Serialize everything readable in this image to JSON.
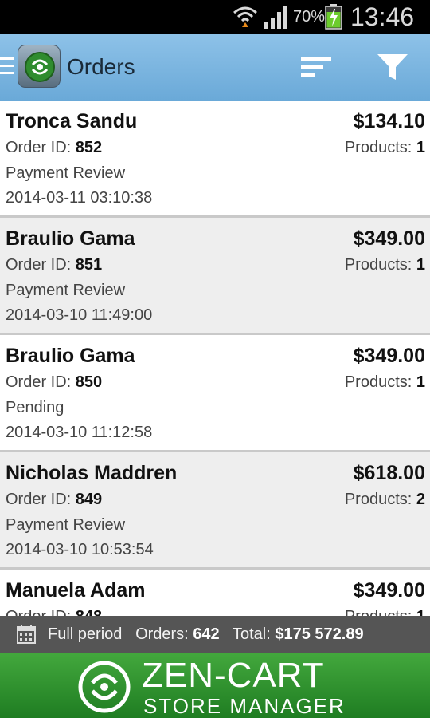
{
  "status_bar": {
    "battery_percent": "70%",
    "time": "13:46"
  },
  "action_bar": {
    "title": "Orders"
  },
  "order_id_label": "Order ID: ",
  "products_label": "Products: ",
  "orders": [
    {
      "customer": "Tronca Sandu",
      "total": "$134.10",
      "order_id": "852",
      "products": "1",
      "status": "Payment Review",
      "date": "2014-03-11 03:10:38"
    },
    {
      "customer": "Braulio Gama",
      "total": "$349.00",
      "order_id": "851",
      "products": "1",
      "status": "Payment Review",
      "date": "2014-03-10 11:49:00"
    },
    {
      "customer": "Braulio Gama",
      "total": "$349.00",
      "order_id": "850",
      "products": "1",
      "status": "Pending",
      "date": "2014-03-10 11:12:58"
    },
    {
      "customer": "Nicholas Maddren",
      "total": "$618.00",
      "order_id": "849",
      "products": "2",
      "status": "Payment Review",
      "date": "2014-03-10 10:53:54"
    },
    {
      "customer": "Manuela Adam",
      "total": "$349.00",
      "order_id": "848",
      "products": "1",
      "status": "",
      "date": ""
    }
  ],
  "summary": {
    "period": "Full period",
    "orders_label": "Orders:",
    "orders_count": "642",
    "total_label": "Total:",
    "total_value": "$175 572.89"
  },
  "banner": {
    "brand": "ZEN-CART",
    "subtitle": "STORE MANAGER"
  }
}
